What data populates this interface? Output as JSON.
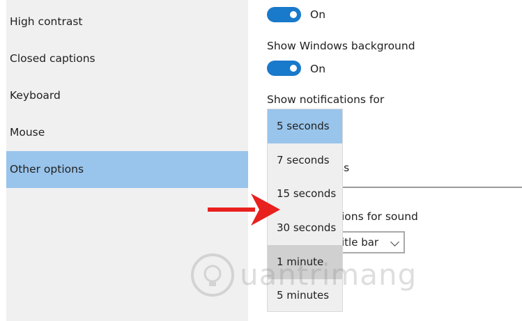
{
  "sidebar": {
    "items": [
      {
        "label": "High contrast"
      },
      {
        "label": "Closed captions"
      },
      {
        "label": "Keyboard"
      },
      {
        "label": "Mouse"
      },
      {
        "label": "Other options"
      }
    ],
    "selected": "Other options"
  },
  "settings": {
    "toggle1": {
      "state": "On"
    },
    "background": {
      "label": "Show Windows background",
      "state": "On"
    },
    "notifications": {
      "label": "Show notifications for"
    },
    "partial_label_1": "ss",
    "partial_label_2": "ions for sound",
    "visual_combo": {
      "value": "itle bar"
    }
  },
  "dropdown": {
    "options": [
      {
        "label": "5 seconds"
      },
      {
        "label": "7 seconds"
      },
      {
        "label": "15 seconds"
      },
      {
        "label": "30 seconds"
      },
      {
        "label": "1 minute"
      },
      {
        "label": "5 minutes"
      }
    ],
    "selected": "5 seconds",
    "hovered": "1 minute"
  },
  "watermark": {
    "text": "uantrimang"
  },
  "colors": {
    "accent": "#1979ca",
    "selection": "#99c4eb",
    "sidebar_bg": "#f0f0f0",
    "arrow": "#e8201e"
  }
}
